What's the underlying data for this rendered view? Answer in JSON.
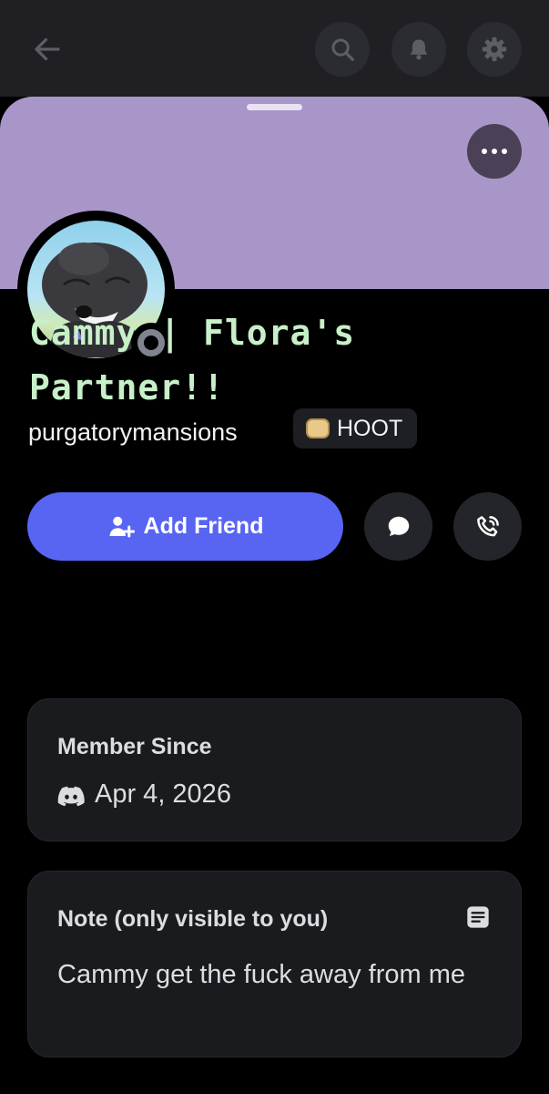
{
  "header": {
    "back_icon": "arrow-left-icon",
    "actions": [
      "search-icon",
      "bell-icon",
      "gear-icon"
    ]
  },
  "profile": {
    "banner_color": "#a896c9",
    "display_name_line1": "Cammy | Flora's",
    "display_name_line2": "Partner!!",
    "display_name_color": "#c7f0c9",
    "status": "offline",
    "username": "purgatorymansions",
    "tag": {
      "icon": "guild-tag-badge-icon",
      "label": "HOOT"
    }
  },
  "actions": {
    "add_friend_label": "Add Friend",
    "message_icon": "chat-bubble-icon",
    "call_icon": "phone-call-icon",
    "accent": "#5865f2"
  },
  "member_since": {
    "title": "Member Since",
    "icon": "discord-icon",
    "date": "Apr 4, 2026"
  },
  "note": {
    "title": "Note (only visible to you)",
    "icon": "note-icon",
    "text": "Cammy get the fuck away from me"
  }
}
